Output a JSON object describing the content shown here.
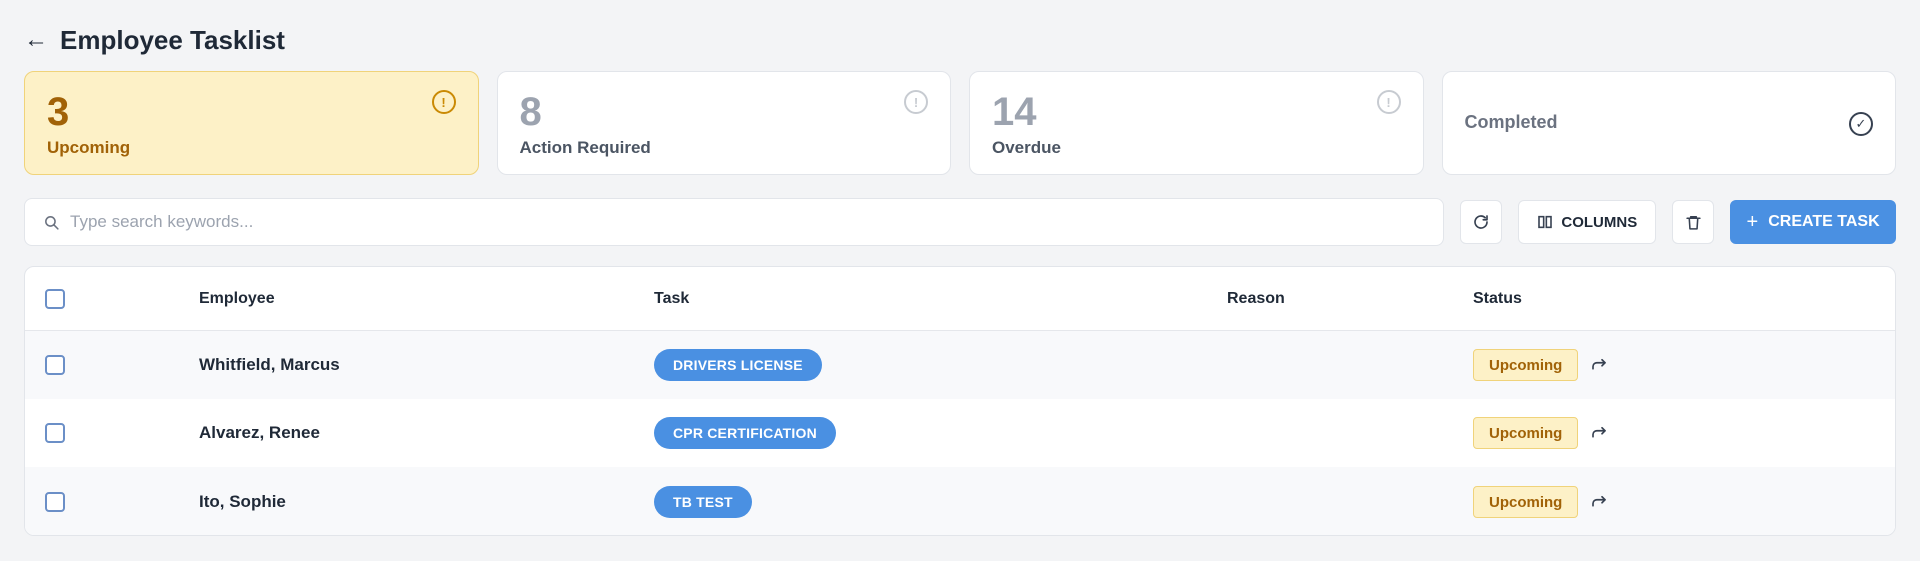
{
  "header": {
    "back_icon": "arrow-left-icon",
    "back_glyph": "←",
    "title": "Employee Tasklist"
  },
  "summary_cards": [
    {
      "count": "3",
      "label": "Upcoming",
      "icon": "alert-circle-icon",
      "glyph": "!",
      "active": true
    },
    {
      "count": "8",
      "label": "Action Required",
      "icon": "alert-circle-icon",
      "glyph": "!",
      "active": false
    },
    {
      "count": "14",
      "label": "Overdue",
      "icon": "alert-circle-icon",
      "glyph": "!",
      "active": false
    },
    {
      "count": "",
      "label": "Completed",
      "icon": "check-circle-icon",
      "glyph": "✓",
      "active": false
    }
  ],
  "toolbar": {
    "search_placeholder": "Type search keywords...",
    "search_value": "",
    "columns_label": "COLUMNS",
    "create_label": "CREATE TASK",
    "create_glyph": "+"
  },
  "table": {
    "headers": {
      "employee": "Employee",
      "task": "Task",
      "reason": "Reason",
      "status": "Status"
    },
    "rows": [
      {
        "employee": "Whitfield, Marcus",
        "task": "DRIVERS LICENSE",
        "reason": "",
        "status": "Upcoming"
      },
      {
        "employee": "Alvarez, Renee",
        "task": "CPR CERTIFICATION",
        "reason": "",
        "status": "Upcoming"
      },
      {
        "employee": "Ito, Sophie",
        "task": "TB TEST",
        "reason": "",
        "status": "Upcoming"
      }
    ]
  },
  "colors": {
    "accent": "#4a90e2",
    "upcoming_bg": "#fdf1c7",
    "upcoming_text": "#a16207",
    "page_bg": "#f3f4f6"
  }
}
